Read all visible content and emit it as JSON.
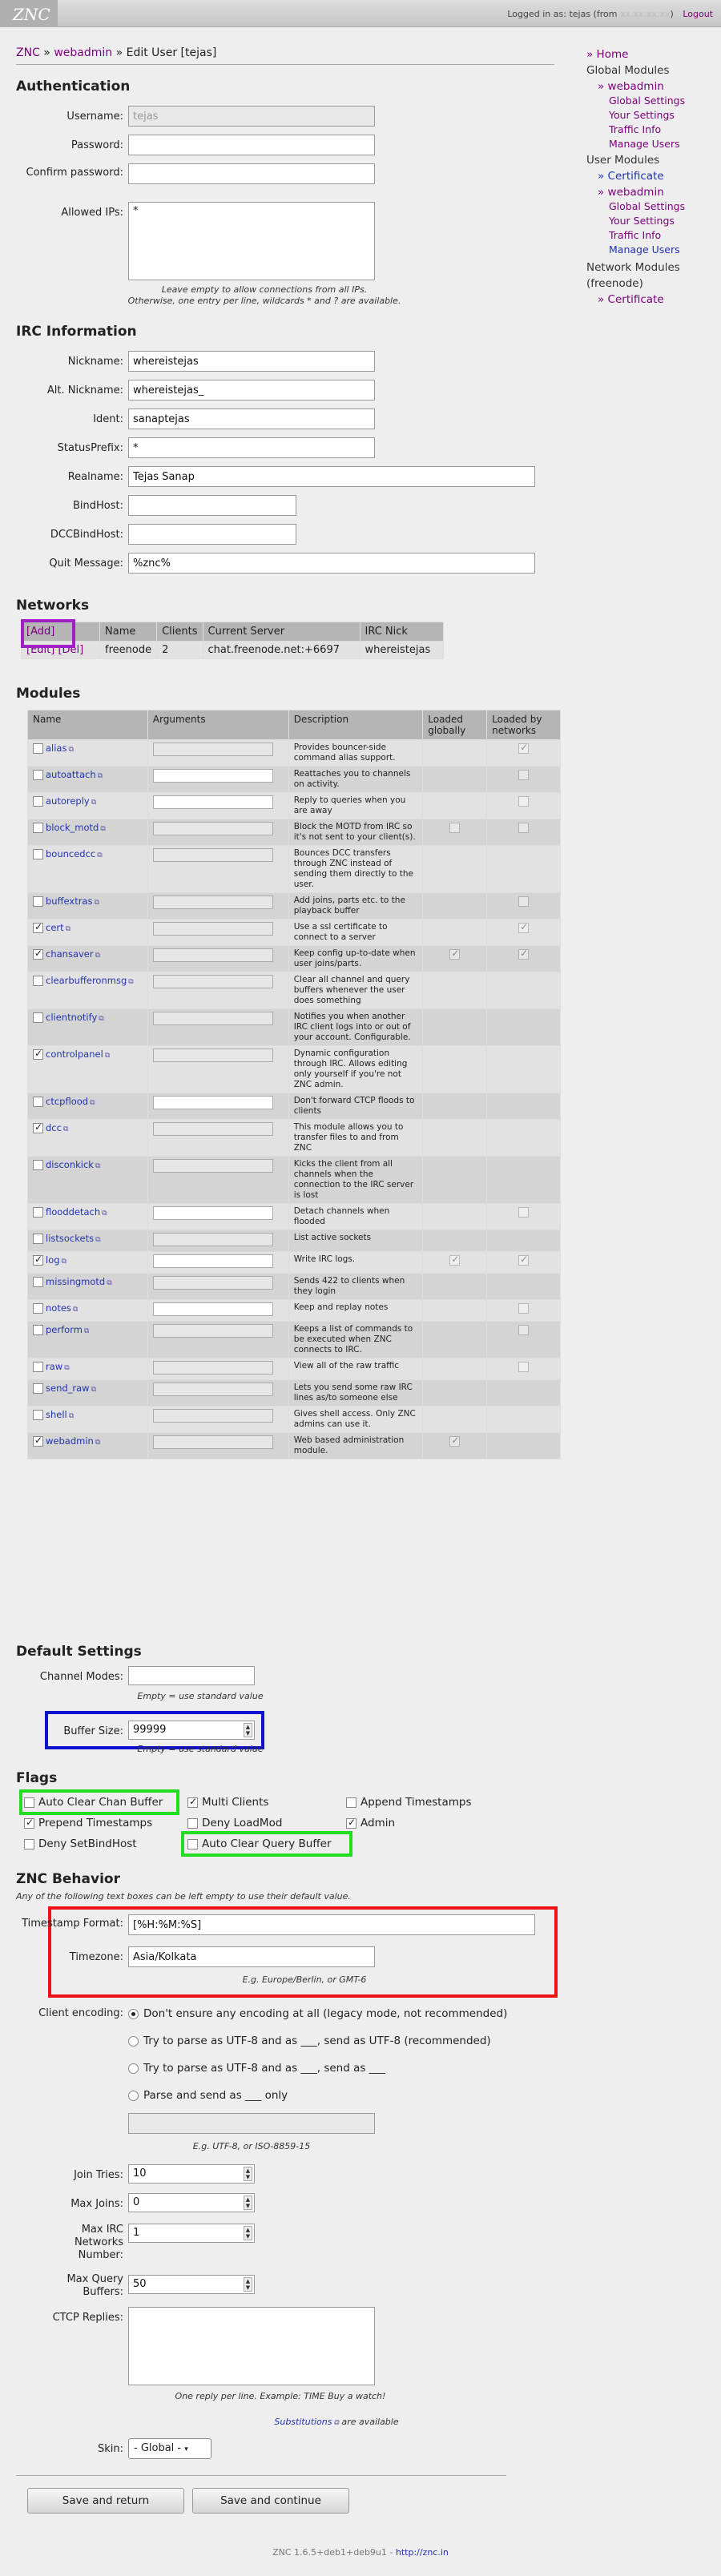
{
  "topbar": {
    "logo": "ZNC",
    "logged_in_as": "Logged in as: tejas (from",
    "logged_in_host": "xx.xx.xx.xx",
    "logged_in_end": ")",
    "logout": "Logout"
  },
  "breadcrumb": {
    "part1": "ZNC",
    "sep1": " » ",
    "part2": "webadmin",
    "sep2": " » ",
    "part3": "Edit User [tejas]"
  },
  "sidebar": {
    "home": "» Home",
    "global_modules": "Global Modules",
    "webadmin": "» webadmin",
    "global_settings": "Global Settings",
    "your_settings": "Your Settings",
    "traffic_info": "Traffic Info",
    "manage_users": "Manage Users",
    "user_modules": "User Modules",
    "certificate": "» Certificate",
    "webadmin2": "» webadmin",
    "global_settings2": "Global Settings",
    "your_settings2": "Your Settings",
    "traffic_info2": "Traffic Info",
    "manage_users2": "Manage Users",
    "network_modules": "Network Modules (freenode)",
    "certificate2": "» Certificate"
  },
  "auth": {
    "heading": "Authentication",
    "username_label": "Username:",
    "username_value": "tejas",
    "password_label": "Password:",
    "confirm_label": "Confirm password:",
    "allowed_ips_label": "Allowed IPs:",
    "allowed_ips_value": "*",
    "hint1": "Leave empty to allow connections from all IPs.",
    "hint2": "Otherwise, one entry per line, wildcards * and ? are available."
  },
  "irc": {
    "heading": "IRC Information",
    "nick_label": "Nickname:",
    "nick_value": "whereistejas",
    "altnick_label": "Alt. Nickname:",
    "altnick_value": "whereistejas_",
    "ident_label": "Ident:",
    "ident_value": "sanaptejas",
    "statusprefix_label": "StatusPrefix:",
    "statusprefix_value": "*",
    "realname_label": "Realname:",
    "realname_value": "Tejas Sanap",
    "bindhost_label": "BindHost:",
    "dccbindhost_label": "DCCBindHost:",
    "quit_label": "Quit Message:",
    "quit_value": "%znc%"
  },
  "networks": {
    "heading": "Networks",
    "add": "[Add]",
    "col_name": "Name",
    "col_clients": "Clients",
    "col_server": "Current Server",
    "col_nick": "IRC Nick",
    "edit": "[Edit]",
    "del": "[Del]",
    "row": {
      "name": "freenode",
      "clients": "2",
      "server": "chat.freenode.net:+6697",
      "nick": "whereistejas"
    }
  },
  "modules": {
    "heading": "Modules",
    "col_name": "Name",
    "col_args": "Arguments",
    "col_desc": "Description",
    "col_global": "Loaded globally",
    "col_networks": "Loaded by networks",
    "rows": [
      {
        "name": "alias",
        "on": false,
        "args": "dis",
        "desc": "Provides bouncer-side command alias support.",
        "g": "",
        "n": "on-dim"
      },
      {
        "name": "autoattach",
        "on": false,
        "args": "en",
        "desc": "Reattaches you to channels on activity.",
        "g": "",
        "n": "off-dim"
      },
      {
        "name": "autoreply",
        "on": false,
        "args": "en",
        "desc": "Reply to queries when you are away",
        "g": "",
        "n": "off-dim"
      },
      {
        "name": "block_motd",
        "on": false,
        "args": "dis",
        "desc": "Block the MOTD from IRC so it's not sent to your client(s).",
        "g": "off-dim",
        "n": "off-dim"
      },
      {
        "name": "bouncedcc",
        "on": false,
        "args": "dis",
        "desc": "Bounces DCC transfers through ZNC instead of sending them directly to the user.",
        "g": "",
        "n": ""
      },
      {
        "name": "buffextras",
        "on": false,
        "args": "dis",
        "desc": "Add joins, parts etc. to the playback buffer",
        "g": "",
        "n": "off-dim"
      },
      {
        "name": "cert",
        "on": true,
        "args": "dis",
        "desc": "Use a ssl certificate to connect to a server",
        "g": "",
        "n": "on-dim"
      },
      {
        "name": "chansaver",
        "on": true,
        "args": "dis",
        "desc": "Keep config up-to-date when user joins/parts.",
        "g": "on-dim",
        "n": "on-dim"
      },
      {
        "name": "clearbufferonmsg",
        "on": false,
        "args": "dis",
        "desc": "Clear all channel and query buffers whenever the user does something",
        "g": "",
        "n": ""
      },
      {
        "name": "clientnotify",
        "on": false,
        "args": "dis",
        "desc": "Notifies you when another IRC client logs into or out of your account. Configurable.",
        "g": "",
        "n": ""
      },
      {
        "name": "controlpanel",
        "on": true,
        "args": "dis",
        "desc": "Dynamic configuration through IRC. Allows editing only yourself if you're not ZNC admin.",
        "g": "",
        "n": ""
      },
      {
        "name": "ctcpflood",
        "on": false,
        "args": "en",
        "desc": "Don't forward CTCP floods to clients",
        "g": "",
        "n": ""
      },
      {
        "name": "dcc",
        "on": true,
        "args": "dis",
        "desc": "This module allows you to transfer files to and from ZNC",
        "g": "",
        "n": ""
      },
      {
        "name": "disconkick",
        "on": false,
        "args": "dis",
        "desc": "Kicks the client from all channels when the connection to the IRC server is lost",
        "g": "",
        "n": ""
      },
      {
        "name": "flooddetach",
        "on": false,
        "args": "en",
        "desc": "Detach channels when flooded",
        "g": "",
        "n": "off-dim"
      },
      {
        "name": "listsockets",
        "on": false,
        "args": "dis",
        "desc": "List active sockets",
        "g": "",
        "n": ""
      },
      {
        "name": "log",
        "on": true,
        "args": "en",
        "desc": "Write IRC logs.",
        "g": "on-dim",
        "n": "on-dim"
      },
      {
        "name": "missingmotd",
        "on": false,
        "args": "dis",
        "desc": "Sends 422 to clients when they login",
        "g": "",
        "n": ""
      },
      {
        "name": "notes",
        "on": false,
        "args": "en",
        "desc": "Keep and replay notes",
        "g": "",
        "n": "off-dim"
      },
      {
        "name": "perform",
        "on": false,
        "args": "dis",
        "desc": "Keeps a list of commands to be executed when ZNC connects to IRC.",
        "g": "",
        "n": "off-dim"
      },
      {
        "name": "raw",
        "on": false,
        "args": "dis",
        "desc": "View all of the raw traffic",
        "g": "",
        "n": "off-dim"
      },
      {
        "name": "send_raw",
        "on": false,
        "args": "dis",
        "desc": "Lets you send some raw IRC lines as/to someone else",
        "g": "",
        "n": ""
      },
      {
        "name": "shell",
        "on": false,
        "args": "dis",
        "desc": "Gives shell access. Only ZNC admins can use it.",
        "g": "",
        "n": ""
      },
      {
        "name": "webadmin",
        "on": true,
        "args": "dis",
        "desc": "Web based administration module.",
        "g": "on-dim",
        "n": ""
      }
    ]
  },
  "defaults": {
    "heading": "Default Settings",
    "chanmodes_label": "Channel Modes:",
    "chanmodes_hint": "Empty = use standard value",
    "buffer_label": "Buffer Size:",
    "buffer_value": "99999",
    "buffer_hint": "Empty = use standard value"
  },
  "flags": {
    "heading": "Flags",
    "auto_clear_chan": "Auto Clear Chan Buffer",
    "multi_clients": "Multi Clients",
    "append_ts": "Append Timestamps",
    "prepend_ts": "Prepend Timestamps",
    "deny_loadmod": "Deny LoadMod",
    "admin": "Admin",
    "deny_setbindhost": "Deny SetBindHost",
    "auto_clear_query": "Auto Clear Query Buffer"
  },
  "behavior": {
    "heading": "ZNC Behavior",
    "note": "Any of the following text boxes can be left empty to use their default value.",
    "ts_label": "Timestamp Format:",
    "ts_value": "[%H:%M:%S]",
    "tz_label": "Timezone:",
    "tz_value": "Asia/Kolkata",
    "tz_hint": "E.g. Europe/Berlin, or GMT-6",
    "enc_label": "Client encoding:",
    "enc1": "Don't ensure any encoding at all (legacy mode, not recommended)",
    "enc2": "Try to parse as UTF-8 and as ___, send as UTF-8 (recommended)",
    "enc3": "Try to parse as UTF-8 and as ___, send as ___",
    "enc4": "Parse and send as ___ only",
    "enc_hint": "E.g. UTF-8, or ISO-8859-15",
    "jointries_label": "Join Tries:",
    "jointries_value": "10",
    "maxjoins_label": "Max Joins:",
    "maxjoins_value": "0",
    "maxnets_label": "Max IRC Networks Number:",
    "maxnets_value": "1",
    "maxquery_label": "Max Query Buffers:",
    "maxquery_value": "50",
    "ctcp_label": "CTCP Replies:",
    "ctcp_hint": "One reply per line. Example: TIME Buy a watch!",
    "subs_link": "Substitutions",
    "subs_rest": " are available",
    "skin_label": "Skin:",
    "skin_value": "- Global -"
  },
  "buttons": {
    "save_return": "Save and return",
    "save_continue": "Save and continue"
  },
  "footer": {
    "version": "ZNC 1.6.5+deb1+deb9u1 -",
    "link": "http://znc.in"
  }
}
